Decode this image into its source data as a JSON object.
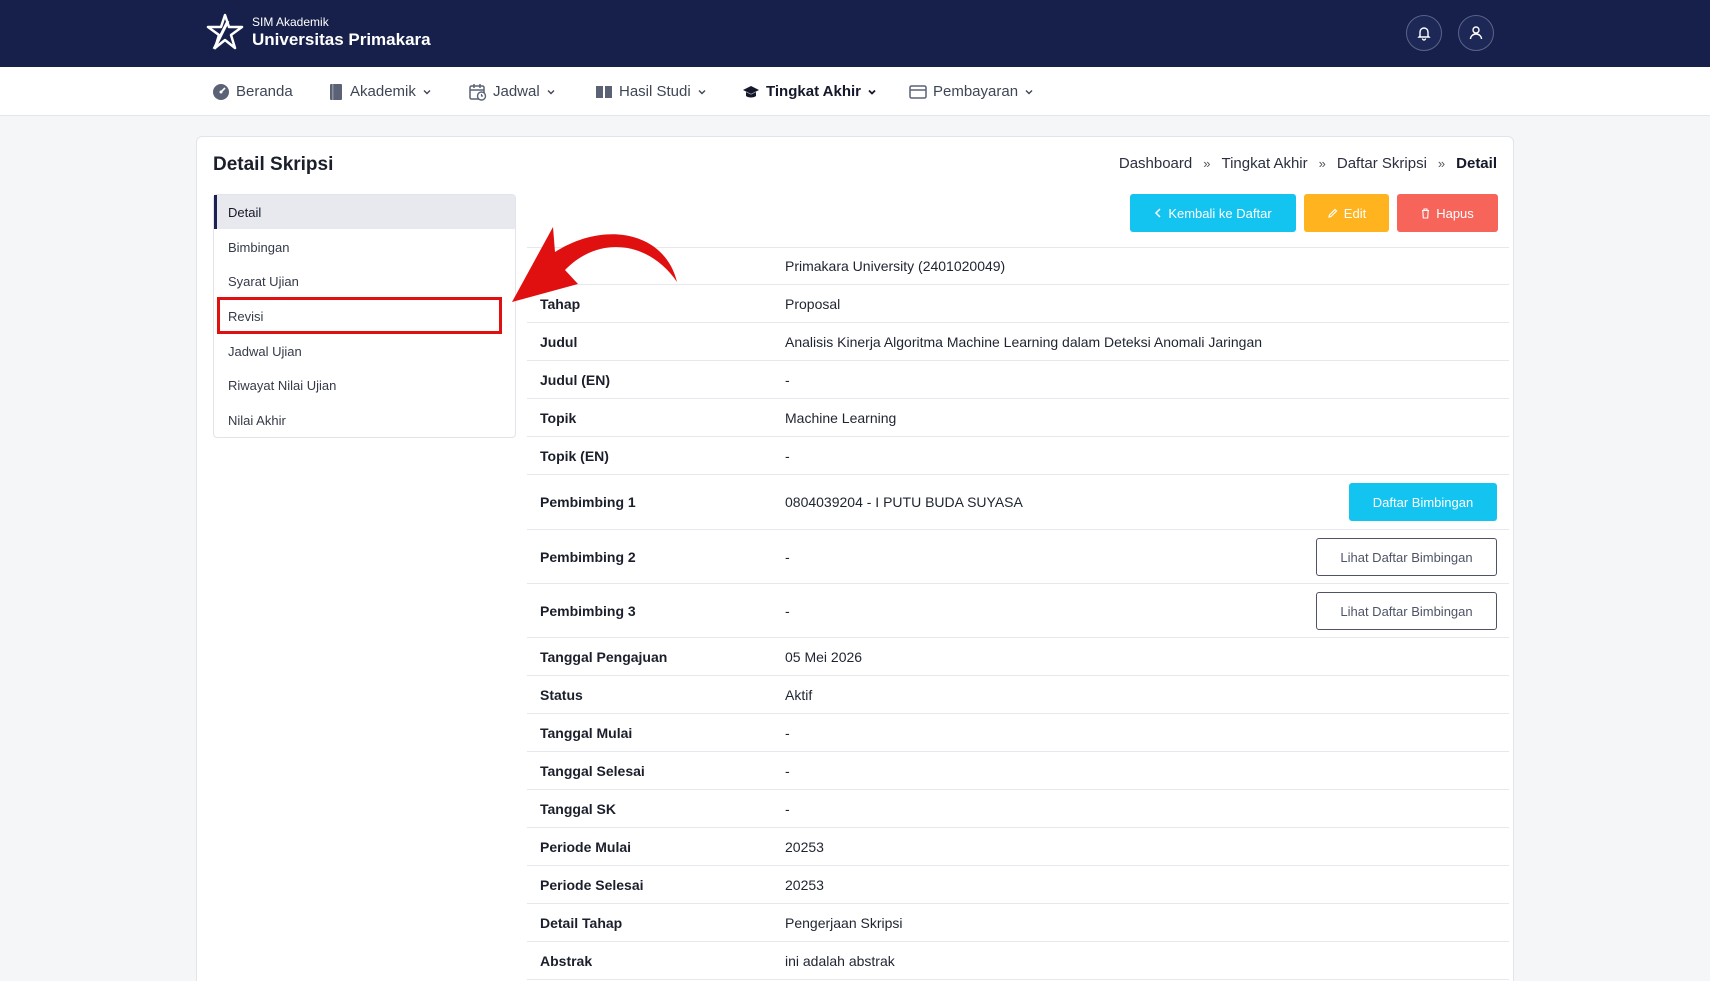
{
  "app": {
    "subtitle": "SIM Akademik",
    "title": "Universitas Primakara"
  },
  "header_icons": [
    "bell-icon",
    "user-icon"
  ],
  "nav": [
    {
      "label": "Beranda",
      "icon": "dashboard-icon",
      "dropdown": false,
      "active": false
    },
    {
      "label": "Akademik",
      "icon": "book-icon",
      "dropdown": true,
      "active": false
    },
    {
      "label": "Jadwal",
      "icon": "calendar-clock-icon",
      "dropdown": true,
      "active": false
    },
    {
      "label": "Hasil Studi",
      "icon": "columns-icon",
      "dropdown": true,
      "active": false
    },
    {
      "label": "Tingkat Akhir",
      "icon": "graduation-cap-icon",
      "dropdown": true,
      "active": true
    },
    {
      "label": "Pembayaran",
      "icon": "card-icon",
      "dropdown": true,
      "active": false
    }
  ],
  "page": {
    "title": "Detail Skripsi",
    "breadcrumb": [
      "Dashboard",
      "Tingkat Akhir",
      "Daftar Skripsi",
      "Detail"
    ],
    "breadcrumb_separator": "»"
  },
  "side_menu": [
    {
      "label": "Detail",
      "active": true
    },
    {
      "label": "Bimbingan",
      "active": false
    },
    {
      "label": "Syarat Ujian",
      "active": false
    },
    {
      "label": "Revisi",
      "active": false,
      "highlighted": true
    },
    {
      "label": "Jadwal Ujian",
      "active": false
    },
    {
      "label": "Riwayat Nilai Ujian",
      "active": false
    },
    {
      "label": "Nilai Akhir",
      "active": false
    }
  ],
  "actions": {
    "back": "Kembali ke Daftar",
    "edit": "Edit",
    "delete": "Hapus"
  },
  "details": [
    {
      "label": "",
      "value": "Primakara University (2401020049)"
    },
    {
      "label": "Tahap",
      "value": "Proposal"
    },
    {
      "label": "Judul",
      "value": "Analisis Kinerja Algoritma Machine Learning dalam Deteksi Anomali Jaringan"
    },
    {
      "label": "Judul (EN)",
      "value": "-"
    },
    {
      "label": "Topik",
      "value": "Machine Learning"
    },
    {
      "label": "Topik (EN)",
      "value": "-"
    },
    {
      "label": "Pembimbing 1",
      "value": "0804039204 - I PUTU BUDA SUYASA",
      "action": "Daftar Bimbingan"
    },
    {
      "label": "Pembimbing 2",
      "value": "-",
      "action": "Lihat Daftar Bimbingan"
    },
    {
      "label": "Pembimbing 3",
      "value": "-",
      "action": "Lihat Daftar Bimbingan"
    },
    {
      "label": "Tanggal Pengajuan",
      "value": "05 Mei 2026"
    },
    {
      "label": "Status",
      "value": "Aktif"
    },
    {
      "label": "Tanggal Mulai",
      "value": "-"
    },
    {
      "label": "Tanggal Selesai",
      "value": "-"
    },
    {
      "label": "Tanggal SK",
      "value": "-"
    },
    {
      "label": "Periode Mulai",
      "value": "20253"
    },
    {
      "label": "Periode Selesai",
      "value": "20253"
    },
    {
      "label": "Detail Tahap",
      "value": "Pengerjaan Skripsi"
    },
    {
      "label": "Abstrak",
      "value": "ini adalah abstrak"
    }
  ],
  "colors": {
    "header_bg": "#16204a",
    "info": "#13c3f0",
    "warning": "#ffb31f",
    "danger": "#f7645a",
    "annotation": "#e01010"
  }
}
